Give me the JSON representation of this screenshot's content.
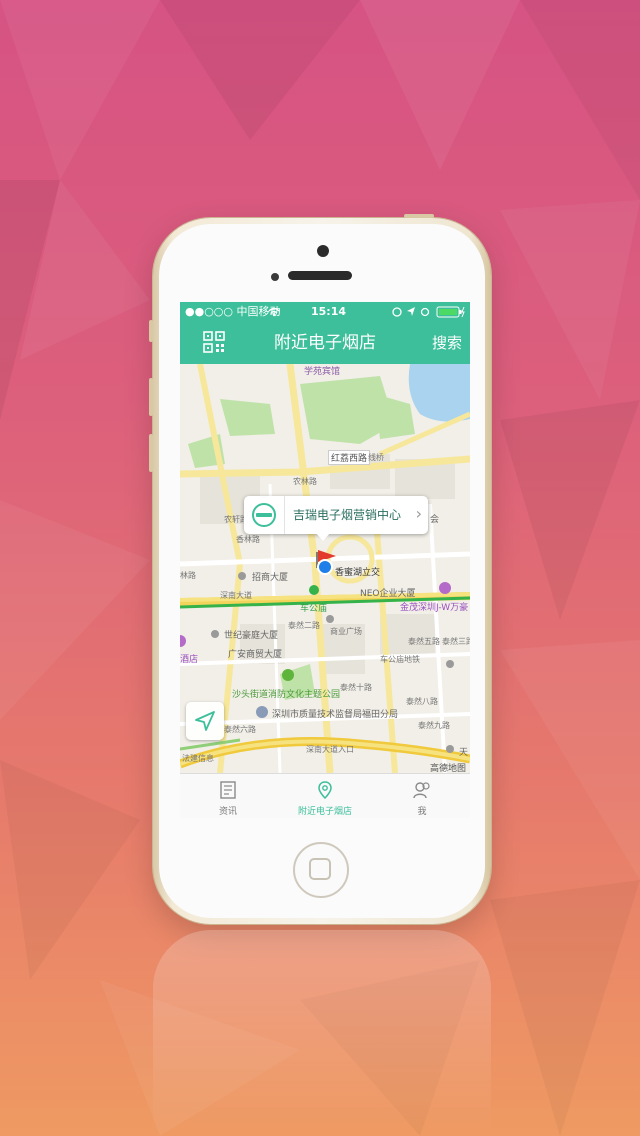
{
  "status": {
    "carrier": "●●○○○ 中国移动",
    "time": "15:14"
  },
  "nav": {
    "title": "附近电子烟店",
    "search_label": "搜索"
  },
  "map": {
    "callout": "吉瑞电子烟营销中心",
    "attribution": "高德地图",
    "labels": {
      "l1": "学苑宾馆",
      "l2": "红荔西路",
      "l3": "线桥",
      "l4": "农林路",
      "l5": "香蜜湖立交",
      "l6": "招商大厦",
      "l7": "深南大道",
      "l8": "车公庙",
      "l9": "NEO企业大厦",
      "l10": "金茂深圳J-W万豪",
      "l11": "世纪豪庭大厦",
      "l12": "泰然二路",
      "l13": "广安商贸大厦",
      "l14": "沙头街道消防文化主题公园",
      "l15": "深圳市质量技术监督局福田分局",
      "l16": "泰然六路",
      "l17": "泰然九路",
      "l18": "法建信息",
      "l19": "会",
      "l20": "林路",
      "l21": "酒店",
      "l22": "泰然五路",
      "l23": "泰然三路",
      "l24": "天",
      "l25": "深南大道入口",
      "l26": "商业广场",
      "l27": "车公庙地铁",
      "l28": "农轩路",
      "l29": "香林路",
      "l30": "泰然十路",
      "l31": "泰然八路"
    }
  },
  "tabs": [
    {
      "label": "资讯"
    },
    {
      "label": "附近电子烟店"
    },
    {
      "label": "我"
    }
  ],
  "colors": {
    "accent": "#3cbf9a",
    "background_top": "#d65383",
    "background_bottom": "#ef9a62"
  }
}
